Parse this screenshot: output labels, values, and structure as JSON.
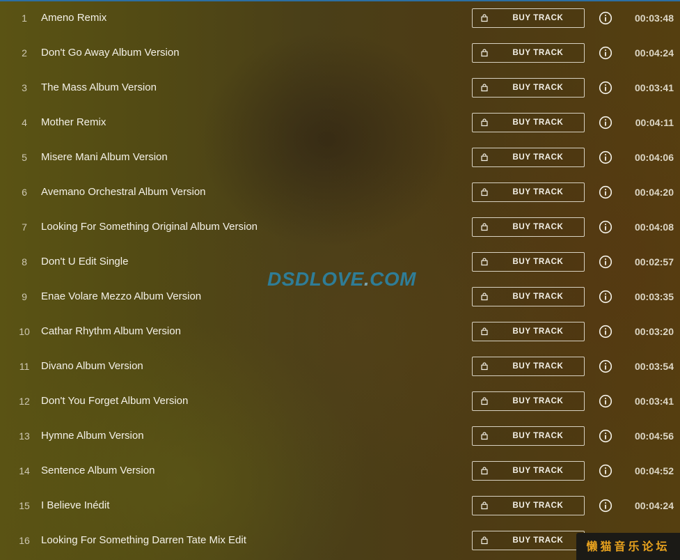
{
  "buy_label": "BUY TRACK",
  "tracks": [
    {
      "num": "1",
      "title": "Ameno Remix",
      "duration": "00:03:48"
    },
    {
      "num": "2",
      "title": "Don't Go Away Album Version",
      "duration": "00:04:24"
    },
    {
      "num": "3",
      "title": "The Mass Album Version",
      "duration": "00:03:41"
    },
    {
      "num": "4",
      "title": "Mother Remix",
      "duration": "00:04:11"
    },
    {
      "num": "5",
      "title": "Misere Mani Album Version",
      "duration": "00:04:06"
    },
    {
      "num": "6",
      "title": "Avemano Orchestral Album Version",
      "duration": "00:04:20"
    },
    {
      "num": "7",
      "title": "Looking For Something Original Album Version",
      "duration": "00:04:08"
    },
    {
      "num": "8",
      "title": "Don't U Edit Single",
      "duration": "00:02:57"
    },
    {
      "num": "9",
      "title": "Enae Volare Mezzo Album Version",
      "duration": "00:03:35"
    },
    {
      "num": "10",
      "title": "Cathar Rhythm Album Version",
      "duration": "00:03:20"
    },
    {
      "num": "11",
      "title": "Divano Album Version",
      "duration": "00:03:54"
    },
    {
      "num": "12",
      "title": "Don't You Forget Album Version",
      "duration": "00:03:41"
    },
    {
      "num": "13",
      "title": "Hymne Album Version",
      "duration": "00:04:56"
    },
    {
      "num": "14",
      "title": "Sentence Album Version",
      "duration": "00:04:52"
    },
    {
      "num": "15",
      "title": "I Believe Inédit",
      "duration": "00:04:24"
    },
    {
      "num": "16",
      "title": "Looking For Something Darren Tate Mix Edit",
      "duration": ""
    }
  ],
  "watermark": {
    "left": "DSDLOVE",
    "sep": ".",
    "right": "COM"
  },
  "corner_badge": "懒猫音乐论坛",
  "icons": {
    "buy": "shopping-bag-icon",
    "info": "info-icon"
  },
  "colors": {
    "accent_blue": "#2c6fa3",
    "watermark": "#2f7d97",
    "badge_text": "#e8a21e"
  }
}
